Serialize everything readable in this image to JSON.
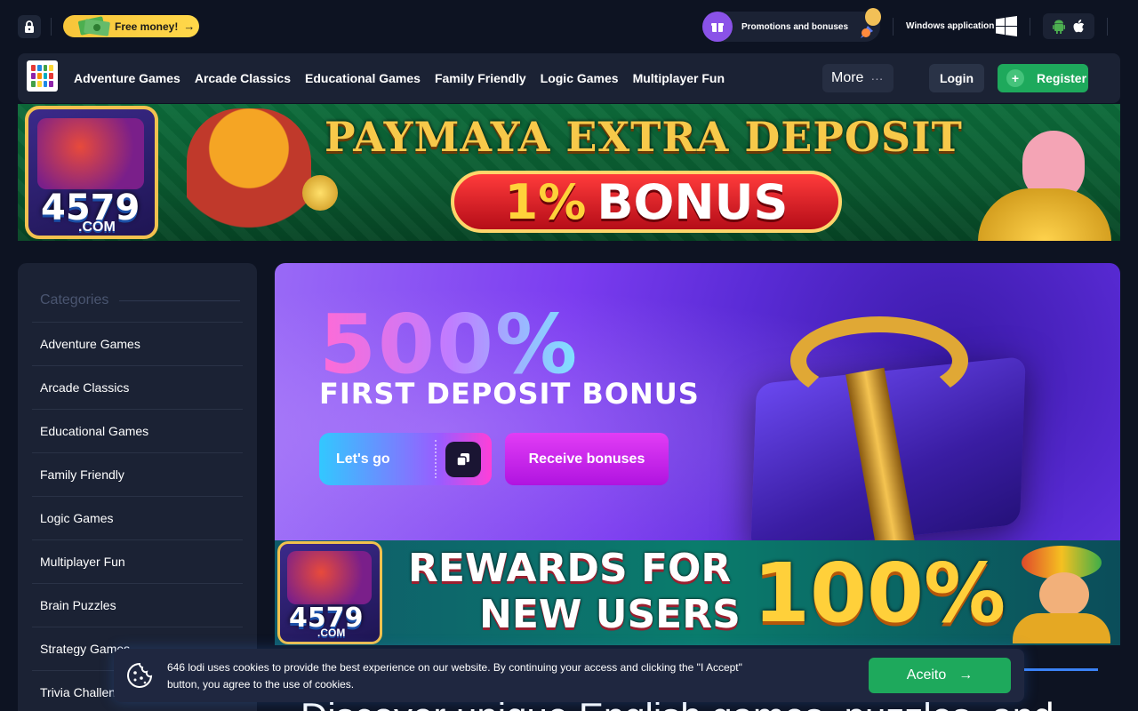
{
  "topbar": {
    "free_money_label": "Free money!",
    "promotions_label": "Promotions and bonuses",
    "windows_app_label": "Windows application"
  },
  "nav": {
    "links": [
      "Adventure Games",
      "Arcade Classics",
      "Educational Games",
      "Family Friendly",
      "Logic Games",
      "Multiplayer Fun"
    ],
    "more_label": "More",
    "login_label": "Login",
    "register_label": "Register"
  },
  "banner_top": {
    "logo_number": "4579",
    "logo_domain": ".COM",
    "title": "PAYMAYA EXTRA DEPOSIT",
    "bonus_percent": "1%",
    "bonus_word": "BONUS"
  },
  "sidebar": {
    "header": "Categories",
    "items": [
      "Adventure Games",
      "Arcade Classics",
      "Educational Games",
      "Family Friendly",
      "Logic Games",
      "Multiplayer Fun",
      "Brain Puzzles",
      "Strategy Games",
      "Trivia Challenges"
    ]
  },
  "hero": {
    "big_text": "500%",
    "sub_text": "FIRST DEPOSIT BONUS",
    "go_label": "Let's go",
    "receive_label": "Receive bonuses"
  },
  "banner_rewards": {
    "logo_number": "4579",
    "logo_domain": ".COM",
    "line1": "REWARDS FOR",
    "line2": "NEW USERS",
    "percent": "100%"
  },
  "main": {
    "heading": "Discover unique English games, puzzles, and"
  },
  "cookie": {
    "text": "646 lodi uses cookies to provide the best experience on our website. By continuing your access and clicking the \"I Accept\" button, you agree to the use of cookies.",
    "accept_label": "Aceito"
  },
  "colors": {
    "background": "#0d1322",
    "panel": "#1b2234",
    "accent_green": "#1ea95c",
    "accent_purple": "#8a52e8",
    "free_money_yellow": "#f7c53a"
  }
}
